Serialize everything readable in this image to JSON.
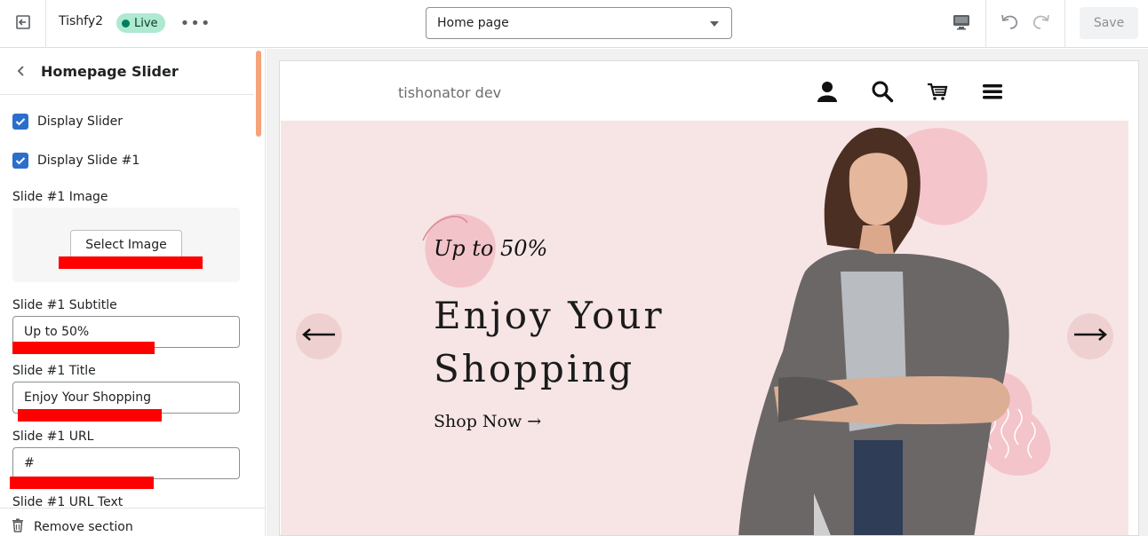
{
  "topbar": {
    "theme_name": "Tishfy2",
    "live_label": "Live",
    "page_select_value": "Home page",
    "save_label": "Save"
  },
  "sidebar": {
    "title": "Homepage Slider",
    "display_slider_label": "Display Slider",
    "display_slider_checked": true,
    "display_slide1_label": "Display Slide #1",
    "display_slide1_checked": true,
    "slide_image_label": "Slide #1 Image",
    "select_image_label": "Select Image",
    "subtitle_label": "Slide #1 Subtitle",
    "subtitle_value": "Up to 50%",
    "title_label": "Slide #1 Title",
    "title_value": "Enjoy Your Shopping",
    "url_label": "Slide #1 URL",
    "url_value": "#",
    "url_text_label": "Slide #1 URL Text",
    "remove_label": "Remove section"
  },
  "preview": {
    "store_name": "tishonator dev",
    "hero_subtitle": "Up to 50%",
    "hero_title": "Enjoy Your Shopping",
    "hero_link": "Shop Now →"
  },
  "colors": {
    "accent": "#2c6ecb",
    "live_badge": "#aee9d1",
    "hero_bg": "#f7e5e5",
    "redaction": "#ff0000"
  }
}
